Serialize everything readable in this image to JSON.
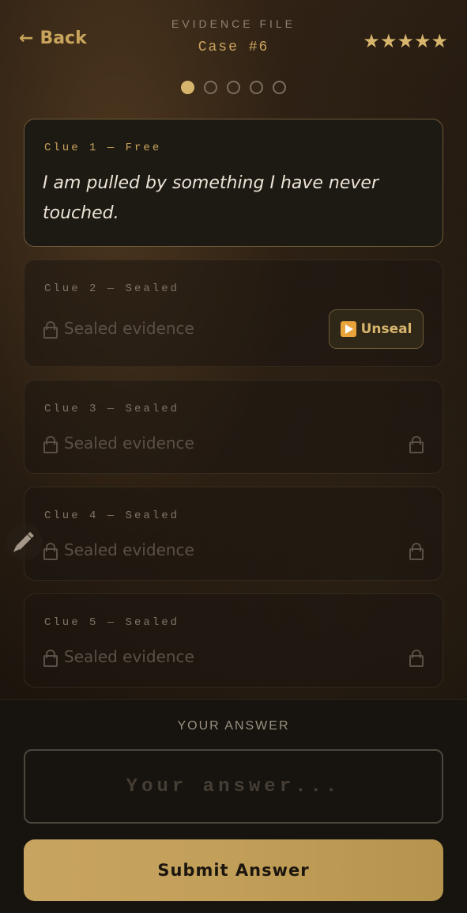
{
  "header": {
    "back_label": "Back",
    "eyebrow": "EVIDENCE FILE",
    "case_title": "Case #6",
    "rating": "★★★★★"
  },
  "pagination": {
    "total": 5,
    "current": 1
  },
  "clues": [
    {
      "label": "Clue 1 — Free",
      "text": "I am pulled by something I have never touched."
    },
    {
      "label": "Clue 2 — Sealed",
      "text": "Sealed evidence",
      "action": "Unseal"
    },
    {
      "label": "Clue 3 — Sealed",
      "text": "Sealed evidence"
    },
    {
      "label": "Clue 4 — Sealed",
      "text": "Sealed evidence"
    },
    {
      "label": "Clue 5 — Sealed",
      "text": "Sealed evidence"
    }
  ],
  "answer": {
    "heading": "YOUR ANSWER",
    "placeholder": "Your answer...",
    "value": "",
    "submit_label": "Submit Answer"
  },
  "colors": {
    "accent": "#c9a45c",
    "background": "#140f0a",
    "submit": "#c29f59"
  },
  "icons": [
    "back-arrow-icon",
    "star-icon",
    "lock-icon",
    "play-icon",
    "pencil-icon"
  ]
}
